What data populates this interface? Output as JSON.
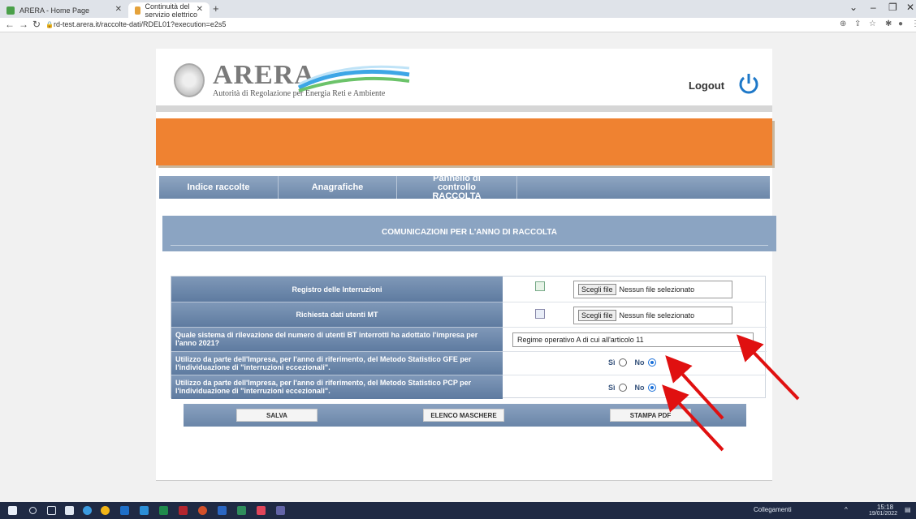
{
  "browser": {
    "tabs": [
      {
        "title": "ARERA - Home Page",
        "active": false
      },
      {
        "title": "Continuità del servizio elettrico",
        "active": true
      }
    ],
    "new_tab_label": "+",
    "url": "rd-test.arera.it/raccolte-dati/RDEL01?execution=e2s5"
  },
  "header": {
    "logo_text": "ARERA",
    "logo_subtitle": "Autorità di Regolazione per Energia Reti e Ambiente",
    "logout_label": "Logout"
  },
  "menu": {
    "items": [
      {
        "label": "Indice raccolte"
      },
      {
        "label": "Anagrafiche"
      },
      {
        "label": "Pannello di controllo RACCOLTA"
      }
    ]
  },
  "section_title": "COMUNICAZIONI PER L'ANNO DI RACCOLTA",
  "form": {
    "registro_label": "Registro delle Interruzioni",
    "richiesta_label": "Richiesta dati utenti MT",
    "file_button": "Scegli file",
    "no_file": "Nessun file selezionato",
    "sistema_label": "Quale sistema di rilevazione del numero di utenti BT interrotti ha adottato l'impresa per l'anno 2021?",
    "sistema_value": "Regime operativo A di cui all'articolo 11",
    "gfe_label": "Utilizzo da parte dell'Impresa, per l'anno di riferimento, del Metodo Statistico GFE per l'individuazione di \"interruzioni eccezionali\".",
    "pcp_label": "Utilizzo da parte dell'Impresa, per l'anno di riferimento, del Metodo Statistico PCP per l'individuazione di \"interruzioni eccezionali\".",
    "si_label": "Sì",
    "no_label": "No",
    "gfe_selected": "No",
    "pcp_selected": "No"
  },
  "actions": {
    "salva": "SALVA",
    "elenco": "ELENCO MASCHERE",
    "stampa": "STAMPA PDF"
  },
  "taskbar": {
    "collegamenti": "Collegamenti",
    "time": "15:18",
    "date": "19/01/2022"
  },
  "colors": {
    "orange_banner": "#ef8231",
    "menu_blue": "#7a94b6",
    "annotation_red": "#e01010"
  }
}
